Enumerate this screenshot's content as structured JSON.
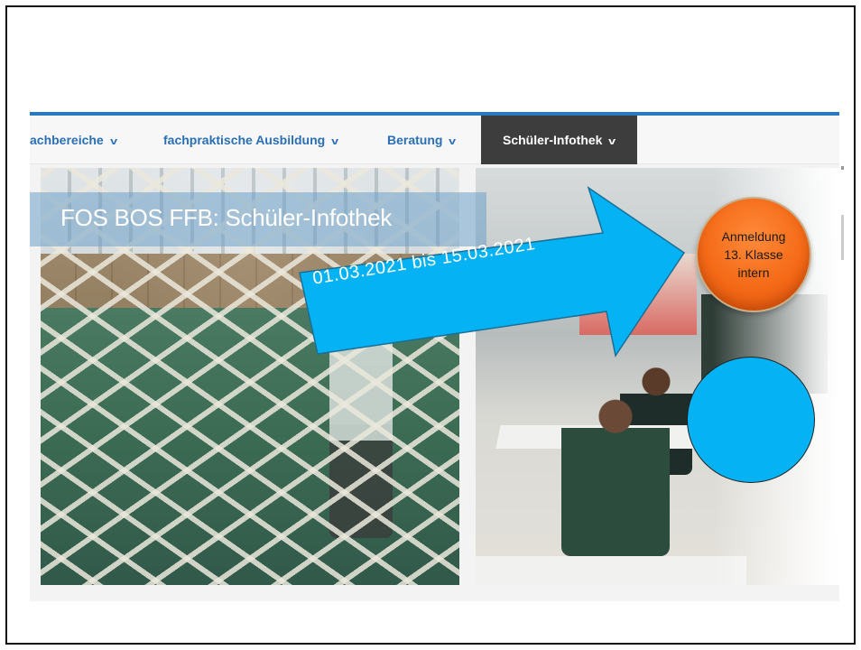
{
  "nav": {
    "items": [
      {
        "label": "achbereiche",
        "chevron": "chevron-down-icon"
      },
      {
        "label": "fachpraktische Ausbildung",
        "chevron": "chevron-down-icon"
      },
      {
        "label": "Beratung",
        "chevron": "chevron-down-icon"
      },
      {
        "label": "Schüler-Infothek",
        "chevron": "chevron-down-icon",
        "active": true
      }
    ]
  },
  "hero": {
    "title": "FOS BOS FFB: Schüler-Infothek"
  },
  "arrow": {
    "text": "01.03.2021 bis 15.03.2021",
    "color": "#05b2f4"
  },
  "badge": {
    "line1": "Anmeldung",
    "line2": "13. Klasse",
    "line3": "intern",
    "color": "#f46a17"
  },
  "circle": {
    "color": "#05b2f4"
  },
  "colors": {
    "accent": "#2a78bd",
    "nav_active_bg": "#3d3d3d"
  }
}
